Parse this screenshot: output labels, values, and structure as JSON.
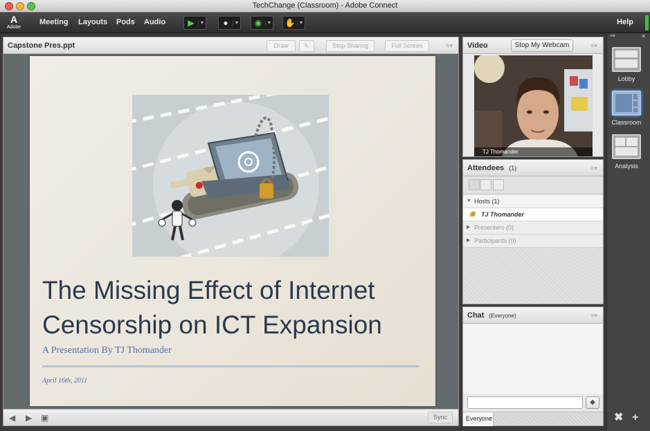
{
  "window": {
    "title": "TechChange (Classroom) - Adobe Connect"
  },
  "logo": {
    "text": "Adobe"
  },
  "menu": {
    "items": [
      "Meeting",
      "Layouts",
      "Pods",
      "Audio"
    ],
    "help": "Help"
  },
  "share_pod": {
    "title": "Capstone Pres.ppt",
    "buttons": {
      "draw": "Draw",
      "stop_sharing": "Stop Sharing",
      "full_screen": "Full Screen"
    },
    "sync": "Sync"
  },
  "slide": {
    "title_line1": "The Missing Effect of Internet",
    "title_line2": "Censorship on ICT Expansion",
    "subtitle": "A Presentation By TJ Thomander",
    "date": "April 16th, 2011"
  },
  "video_pod": {
    "title": "Video",
    "stop_webcam": "Stop My Webcam",
    "name_tag": "TJ Thomander"
  },
  "attendees_pod": {
    "title": "Attendees",
    "count": "(1)",
    "groups": {
      "hosts": "Hosts (1)",
      "presenters": "Presenters (0)",
      "participants": "Participants (0)"
    },
    "host_name": "TJ Thomander"
  },
  "chat_pod": {
    "title": "Chat",
    "scope": "(Everyone)",
    "tab": "Everyone"
  },
  "layouts": {
    "items": [
      "Lobby",
      "Classroom",
      "Analysis"
    ],
    "active": "Classroom"
  },
  "colors": {
    "accent_green": "#3fbf3f",
    "slide_title": "#2a3a4f",
    "slide_subtitle": "#5270a3",
    "active_layout_glow": "#6fb0ff"
  }
}
